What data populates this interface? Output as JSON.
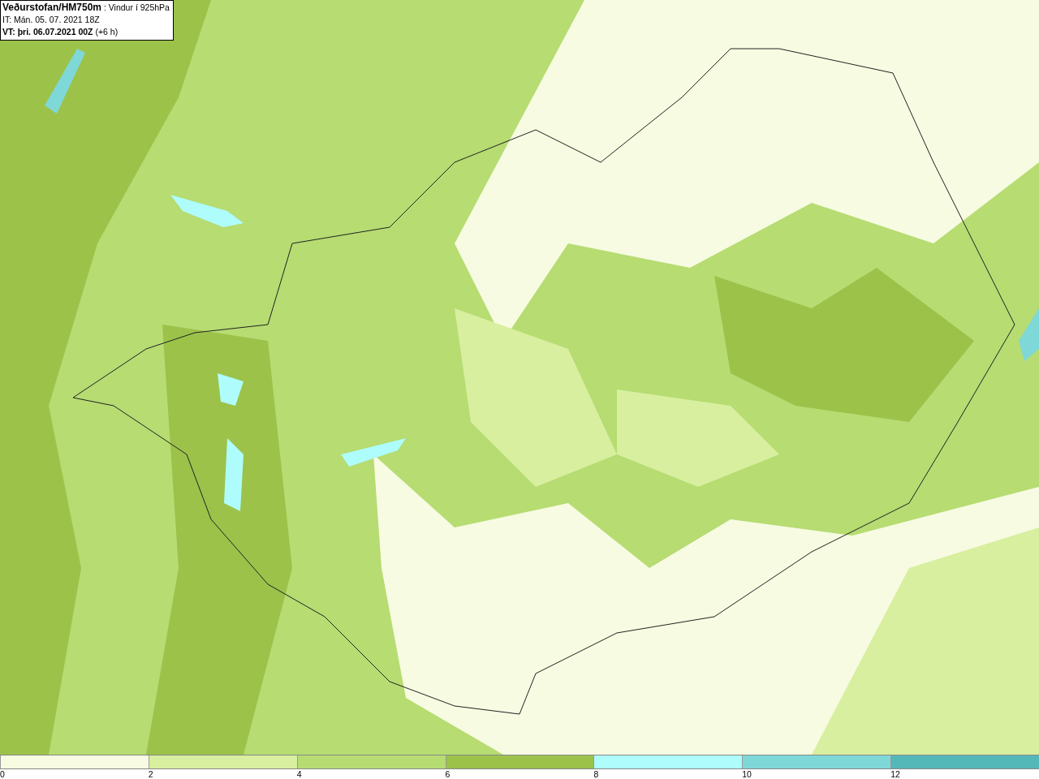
{
  "header": {
    "title_line": "**Veðurstofan/HM750m** : Vindur í 925hPa",
    "it_line": "IT: Mán. 05. 07. 2021 18Z",
    "vt_line": "**VT: þri. 06.07.2021 00Z** (+6 h)"
  },
  "legend": [
    {
      "label": "0",
      "color": "#f7fbe1"
    },
    {
      "label": "2",
      "color": "#d7ef9f"
    },
    {
      "label": "4",
      "color": "#b6dc72"
    },
    {
      "label": "6",
      "color": "#9cc24a"
    },
    {
      "label": "8",
      "color": "#aefcfc"
    },
    {
      "label": "10",
      "color": "#7ed8d8"
    },
    {
      "label": "12",
      "color": "#55b8b8"
    }
  ]
}
